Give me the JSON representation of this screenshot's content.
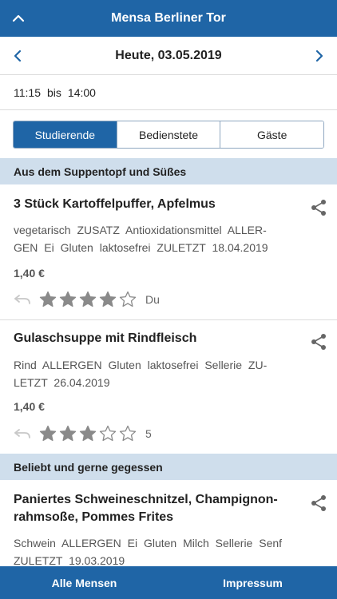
{
  "header": {
    "title": "Mensa Berliner Tor"
  },
  "datebar": {
    "date": "Heute, 03.05.2019"
  },
  "hours": {
    "from": "11:15",
    "separator": "bis",
    "to": "14:00"
  },
  "segments": [
    {
      "label": "Studierende",
      "active": true
    },
    {
      "label": "Bedienstete",
      "active": false
    },
    {
      "label": "Gäste",
      "active": false
    }
  ],
  "sections": [
    {
      "title": "Aus dem Suppentopf und Süßes"
    },
    {
      "title": "Beliebt und gerne gegessen"
    }
  ],
  "meals": [
    {
      "name": "3 Stück Kartoffelpuffer, Apfelmus",
      "tags": "vegetarisch ZUSATZ Antioxidationsmittel ALLER-GEN Ei Gluten laktosefrei ZULETZT 18.04.2019",
      "price": "1,40 €",
      "rating": 4,
      "rating_label": "Du"
    },
    {
      "name": "Gulaschsuppe mit Rindfleisch",
      "tags": "Rind ALLERGEN Gluten laktosefrei Sellerie ZU-LETZT 26.04.2019",
      "price": "1,40 €",
      "rating": 3,
      "rating_label": "5"
    },
    {
      "name": "Paniertes Schweineschnitzel, Champignon-rahmsoße, Pommes Frites",
      "tags": "Schwein ALLERGEN Ei Gluten Milch Sellerie Senf ZULETZT 19.03.2019"
    }
  ],
  "bottom_tabs": [
    {
      "label": "Alle Mensen"
    },
    {
      "label": "Impressum"
    }
  ],
  "colors": {
    "primary": "#1f65a6",
    "section_bg": "#cfdeec",
    "star": "#8a8a8a"
  },
  "icons": {
    "back": "chevron-up-icon",
    "prev": "chevron-left-icon",
    "next": "chevron-right-icon",
    "share": "share-icon",
    "undo": "undo-icon",
    "star": "star-icon"
  }
}
